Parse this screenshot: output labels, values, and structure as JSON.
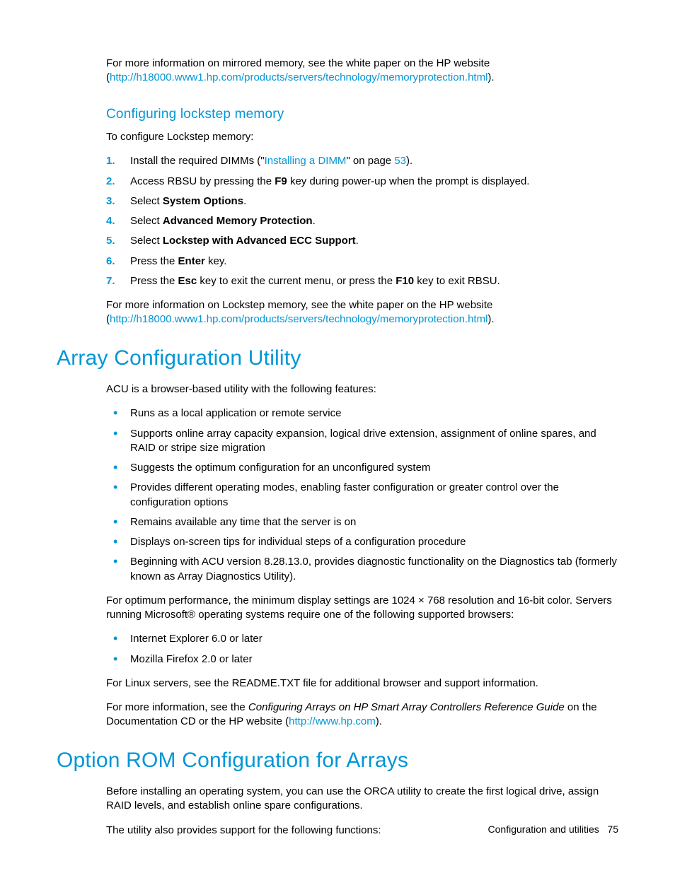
{
  "intro1": {
    "pre": "For more information on mirrored memory, see the white paper on the HP website (",
    "link": "http://h18000.www1.hp.com/products/servers/technology/memoryprotection.html",
    "post": ")."
  },
  "sub1": {
    "title": "Configuring lockstep memory",
    "lead": "To configure Lockstep memory:",
    "steps": [
      {
        "num": "1.",
        "pre": "Install the required DIMMs (\"",
        "link": "Installing a DIMM",
        "mid": "\" on page ",
        "page": "53",
        "post": ")."
      },
      {
        "num": "2.",
        "pre": "Access RBSU by pressing the ",
        "b1": "F9",
        "post": " key during power-up when the prompt is displayed."
      },
      {
        "num": "3.",
        "pre": "Select ",
        "b1": "System Options",
        "post": "."
      },
      {
        "num": "4.",
        "pre": "Select ",
        "b1": "Advanced Memory Protection",
        "post": "."
      },
      {
        "num": "5.",
        "pre": "Select ",
        "b1": "Lockstep with Advanced ECC Support",
        "post": "."
      },
      {
        "num": "6.",
        "pre": "Press the ",
        "b1": "Enter",
        "post": " key."
      },
      {
        "num": "7.",
        "pre": "Press the ",
        "b1": "Esc",
        "mid": " key to exit the current menu, or press the ",
        "b2": "F10",
        "post": " key to exit RBSU."
      }
    ],
    "outro": {
      "pre": "For more information on Lockstep memory, see the white paper on the HP website (",
      "link": "http://h18000.www1.hp.com/products/servers/technology/memoryprotection.html",
      "post": ")."
    }
  },
  "h1a": {
    "title": "Array Configuration Utility",
    "lead": "ACU is a browser-based utility with the following features:",
    "bullets": [
      "Runs as a local application or remote service",
      "Supports online array capacity expansion, logical drive extension, assignment of online spares, and RAID or stripe size migration",
      "Suggests the optimum configuration for an unconfigured system",
      "Provides different operating modes, enabling faster configuration or greater control over the configuration options",
      "Remains available any time that the server is on",
      "Displays on-screen tips for individual steps of a configuration procedure",
      "Beginning with ACU version 8.28.13.0, provides diagnostic functionality on the Diagnostics tab (formerly known as Array Diagnostics Utility)."
    ],
    "p1": "For optimum performance, the minimum display settings are 1024 × 768 resolution and 16-bit color. Servers running Microsoft® operating systems require one of the following supported browsers:",
    "browsers": [
      "Internet Explorer 6.0 or later",
      "Mozilla Firefox 2.0 or later"
    ],
    "p2": "For Linux servers, see the README.TXT file for additional browser and support information.",
    "p3": {
      "pre": "For more information, see the ",
      "i": "Configuring Arrays on HP Smart Array Controllers Reference Guide",
      "mid": " on the Documentation CD or the HP website (",
      "link": "http://www.hp.com",
      "post": ")."
    }
  },
  "h1b": {
    "title": "Option ROM Configuration for Arrays",
    "p1": "Before installing an operating system, you can use the ORCA utility to create the first logical drive, assign RAID levels, and establish online spare configurations.",
    "p2": "The utility also provides support for the following functions:"
  },
  "footer": {
    "section": "Configuration and utilities",
    "page": "75"
  }
}
